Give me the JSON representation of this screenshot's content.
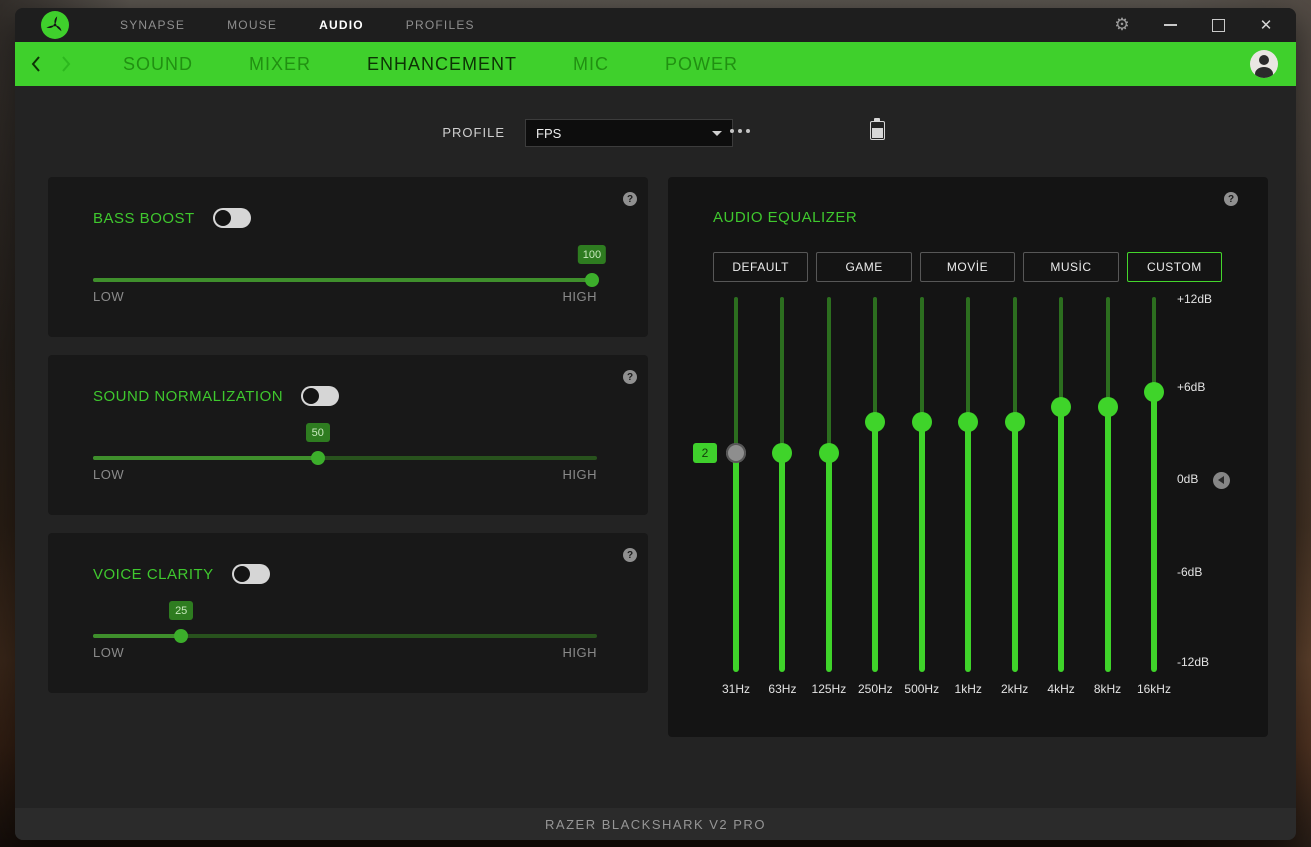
{
  "titlebar": {
    "tabs": [
      {
        "label": "SYNAPSE"
      },
      {
        "label": "MOUSE"
      },
      {
        "label": "AUDIO",
        "active": true
      },
      {
        "label": "PROFILES"
      }
    ]
  },
  "nav": {
    "tabs": [
      {
        "label": "SOUND"
      },
      {
        "label": "MIXER"
      },
      {
        "label": "ENHANCEMENT",
        "active": true
      },
      {
        "label": "MIC"
      },
      {
        "label": "POWER"
      }
    ]
  },
  "profile": {
    "label": "PROFILE",
    "selected": "FPS"
  },
  "misc": {
    "help_glyph": "?"
  },
  "enhancements": {
    "cards": [
      {
        "title": "BASS BOOST",
        "toggle": "off",
        "value": 100,
        "badge": "100",
        "knob_pct": 99,
        "min_label": "LOW",
        "max_label": "HIGH"
      },
      {
        "title": "SOUND NORMALIZATION",
        "toggle": "off",
        "value": 50,
        "badge": "50",
        "knob_pct": 44.6,
        "min_label": "LOW",
        "max_label": "HIGH"
      },
      {
        "title": "VOICE CLARITY",
        "toggle": "off",
        "value": 25,
        "badge": "25",
        "knob_pct": 17.5,
        "min_label": "LOW",
        "max_label": "HIGH"
      }
    ]
  },
  "equalizer": {
    "title": "AUDIO EQUALIZER",
    "presets": [
      {
        "label": "DEFAULT"
      },
      {
        "label": "GAME"
      },
      {
        "label": "MOVİE"
      },
      {
        "label": "MUSİC"
      },
      {
        "label": "CUSTOM",
        "active": true
      }
    ],
    "scale_labels": [
      "+12dB",
      "+6dB",
      "0dB",
      "-6dB",
      "-12dB"
    ],
    "bands": [
      {
        "freq": "31Hz",
        "db": 2,
        "state": "dragging",
        "badge": "2"
      },
      {
        "freq": "63Hz",
        "db": 2
      },
      {
        "freq": "125Hz",
        "db": 2
      },
      {
        "freq": "250Hz",
        "db": 4
      },
      {
        "freq": "500Hz",
        "db": 4
      },
      {
        "freq": "1kHz",
        "db": 4
      },
      {
        "freq": "2kHz",
        "db": 4
      },
      {
        "freq": "4kHz",
        "db": 5
      },
      {
        "freq": "8kHz",
        "db": 5
      },
      {
        "freq": "16kHz",
        "db": 6
      }
    ]
  },
  "footer": {
    "device": "RAZER BLACKSHARK V2 PRO"
  },
  "colors": {
    "accent_green": "#44d62c",
    "greenbar_green": "#3fd02c",
    "track_dim_green": "#2c6e1f",
    "track_bright_green": "#3fd42a"
  }
}
